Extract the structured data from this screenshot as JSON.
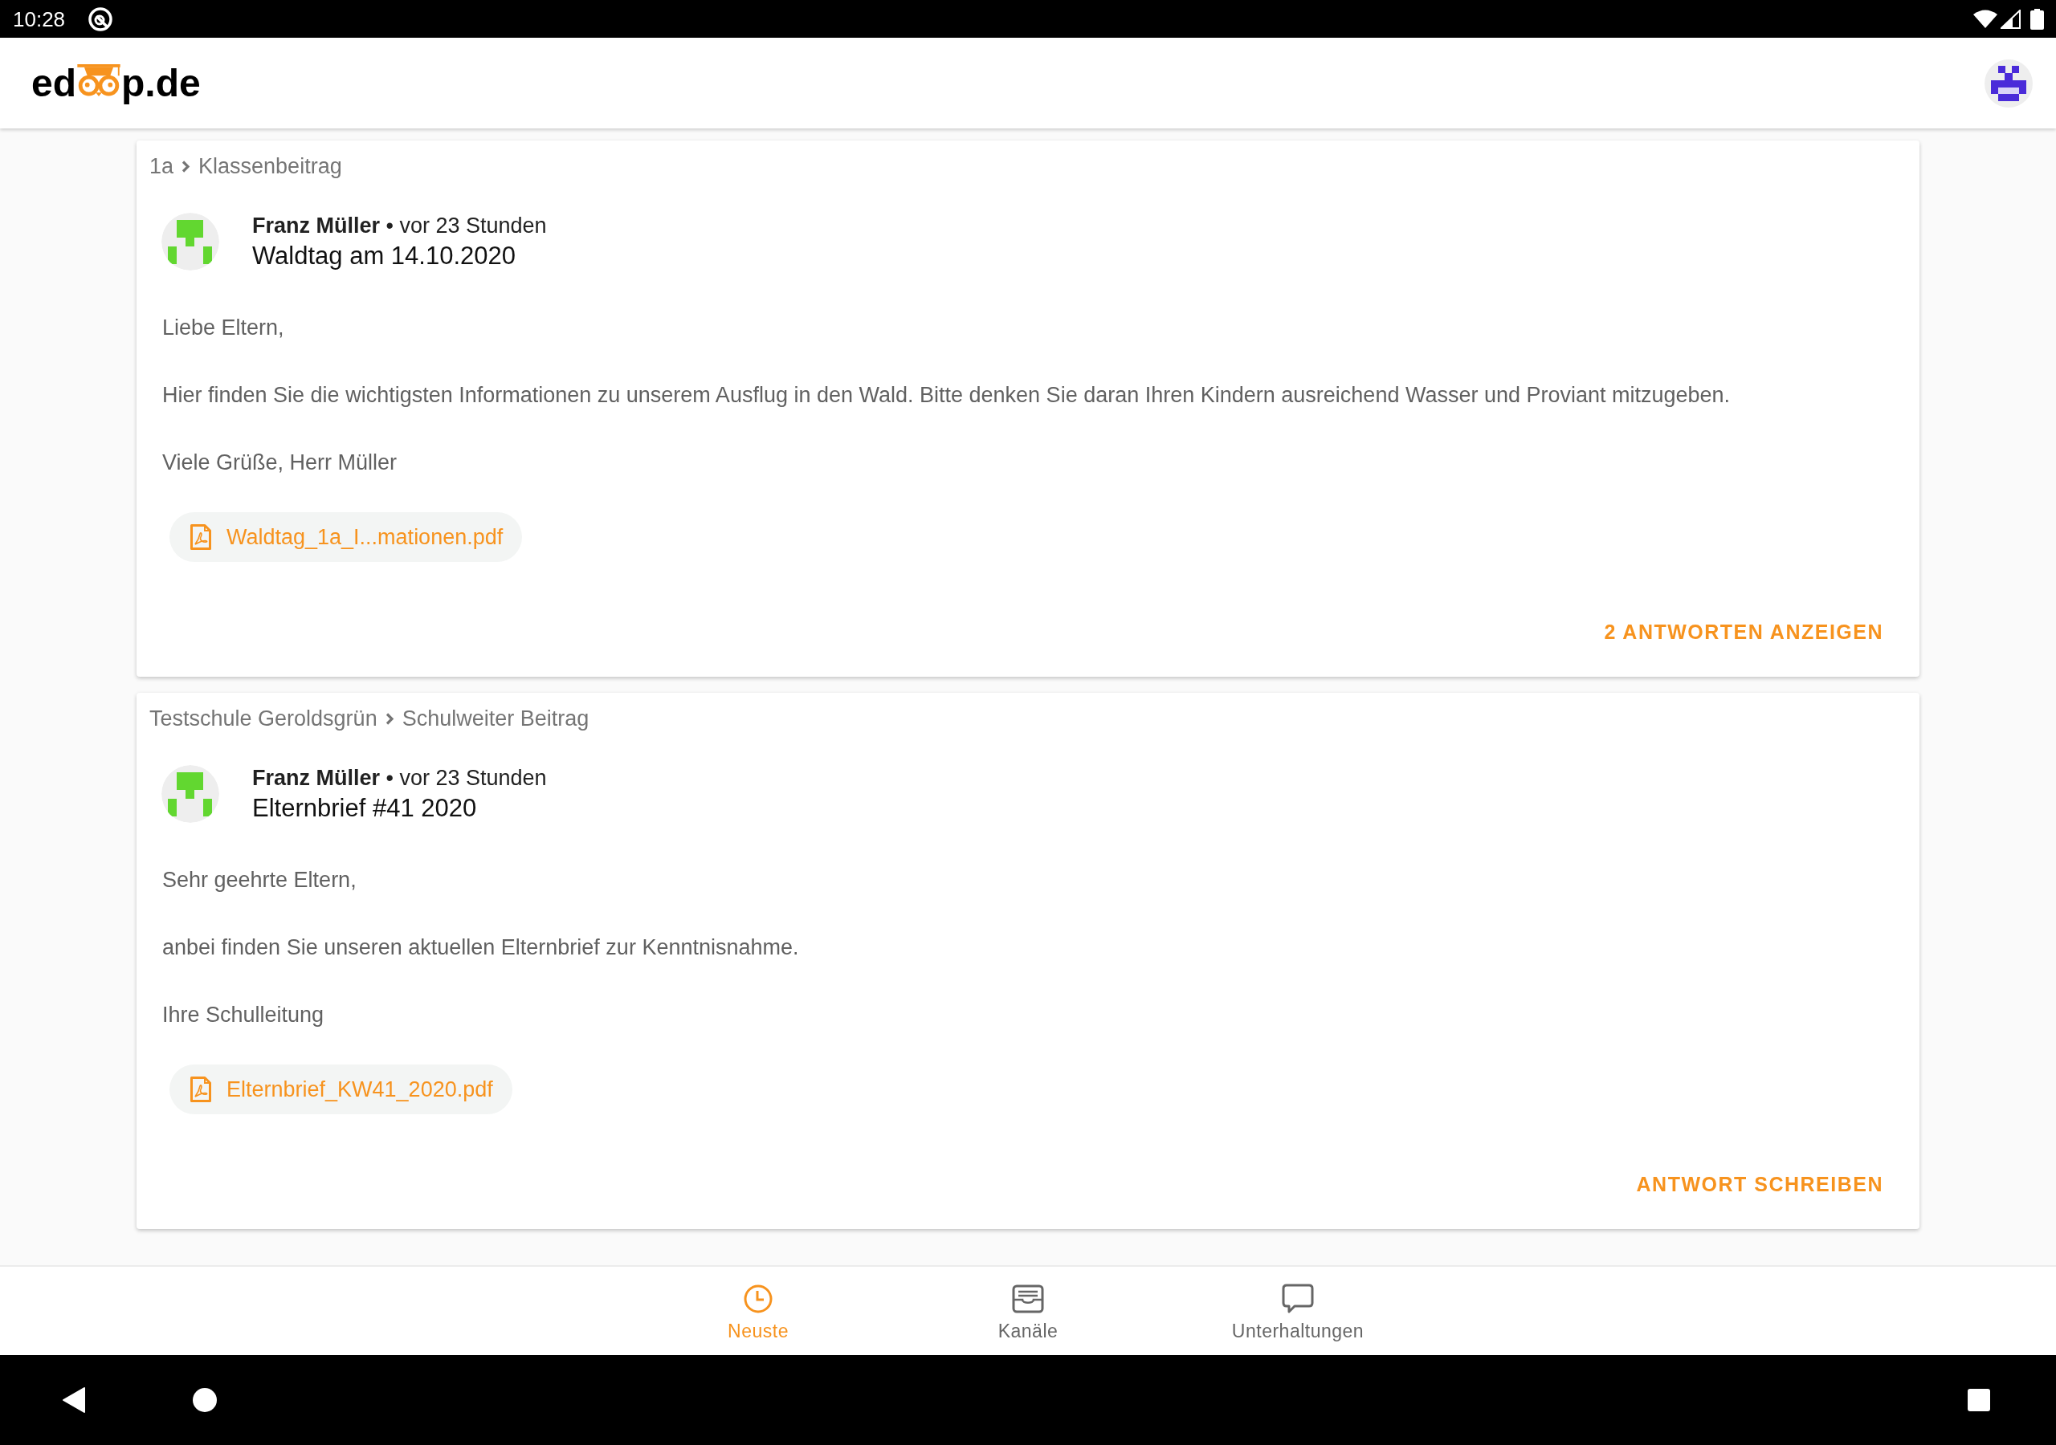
{
  "status_bar": {
    "time": "10:28"
  },
  "app_bar": {
    "logo": {
      "before": "ed",
      "after": "p.de"
    }
  },
  "posts": [
    {
      "breadcrumb": [
        "1a",
        "Klassenbeitrag"
      ],
      "byline": "**Franz Müller** • vor 23 Stunden",
      "title": "Waldtag am 14.10.2020",
      "paragraphs": [
        "Liebe Eltern,",
        "Hier finden Sie die wichtigsten Informationen zu unserem Ausflug in den Wald. Bitte denken Sie daran Ihren Kindern ausreichend Wasser und Proviant mitzugeben.",
        "Viele Grüße, Herr Müller"
      ],
      "attachment": "Waldtag_1a_I...mationen.pdf",
      "action": "2 ANTWORTEN ANZEIGEN"
    },
    {
      "breadcrumb": [
        "Testschule Geroldsgrün",
        "Schulweiter Beitrag"
      ],
      "byline": "**Franz Müller** • vor 23 Stunden",
      "title": "Elternbrief #41 2020",
      "paragraphs": [
        "Sehr geehrte Eltern,",
        "anbei finden Sie unseren aktuellen Elternbrief zur Kenntnisnahme.",
        "Ihre Schulleitung"
      ],
      "attachment": "Elternbrief_KW41_2020.pdf",
      "action": "ANTWORT SCHREIBEN"
    }
  ],
  "bottom_nav": [
    {
      "label": "Neuste",
      "selected": true
    },
    {
      "label": "Kanäle",
      "selected": false
    },
    {
      "label": "Unterhaltungen",
      "selected": false
    }
  ]
}
